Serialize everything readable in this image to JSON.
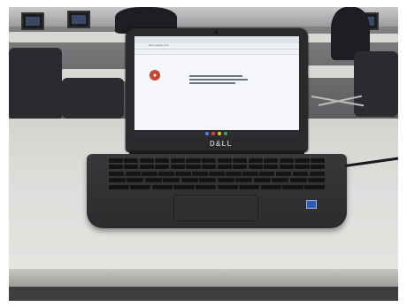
{
  "screen": {
    "address_text": "docs.google.com",
    "brand": "D&LL"
  },
  "colors": {
    "lid": "#2a2a2d",
    "desk": "#dedddb",
    "mic_button": "#c5462f",
    "sticker": "#2a5fb8"
  },
  "icons": {
    "mic": "microphone-icon"
  }
}
